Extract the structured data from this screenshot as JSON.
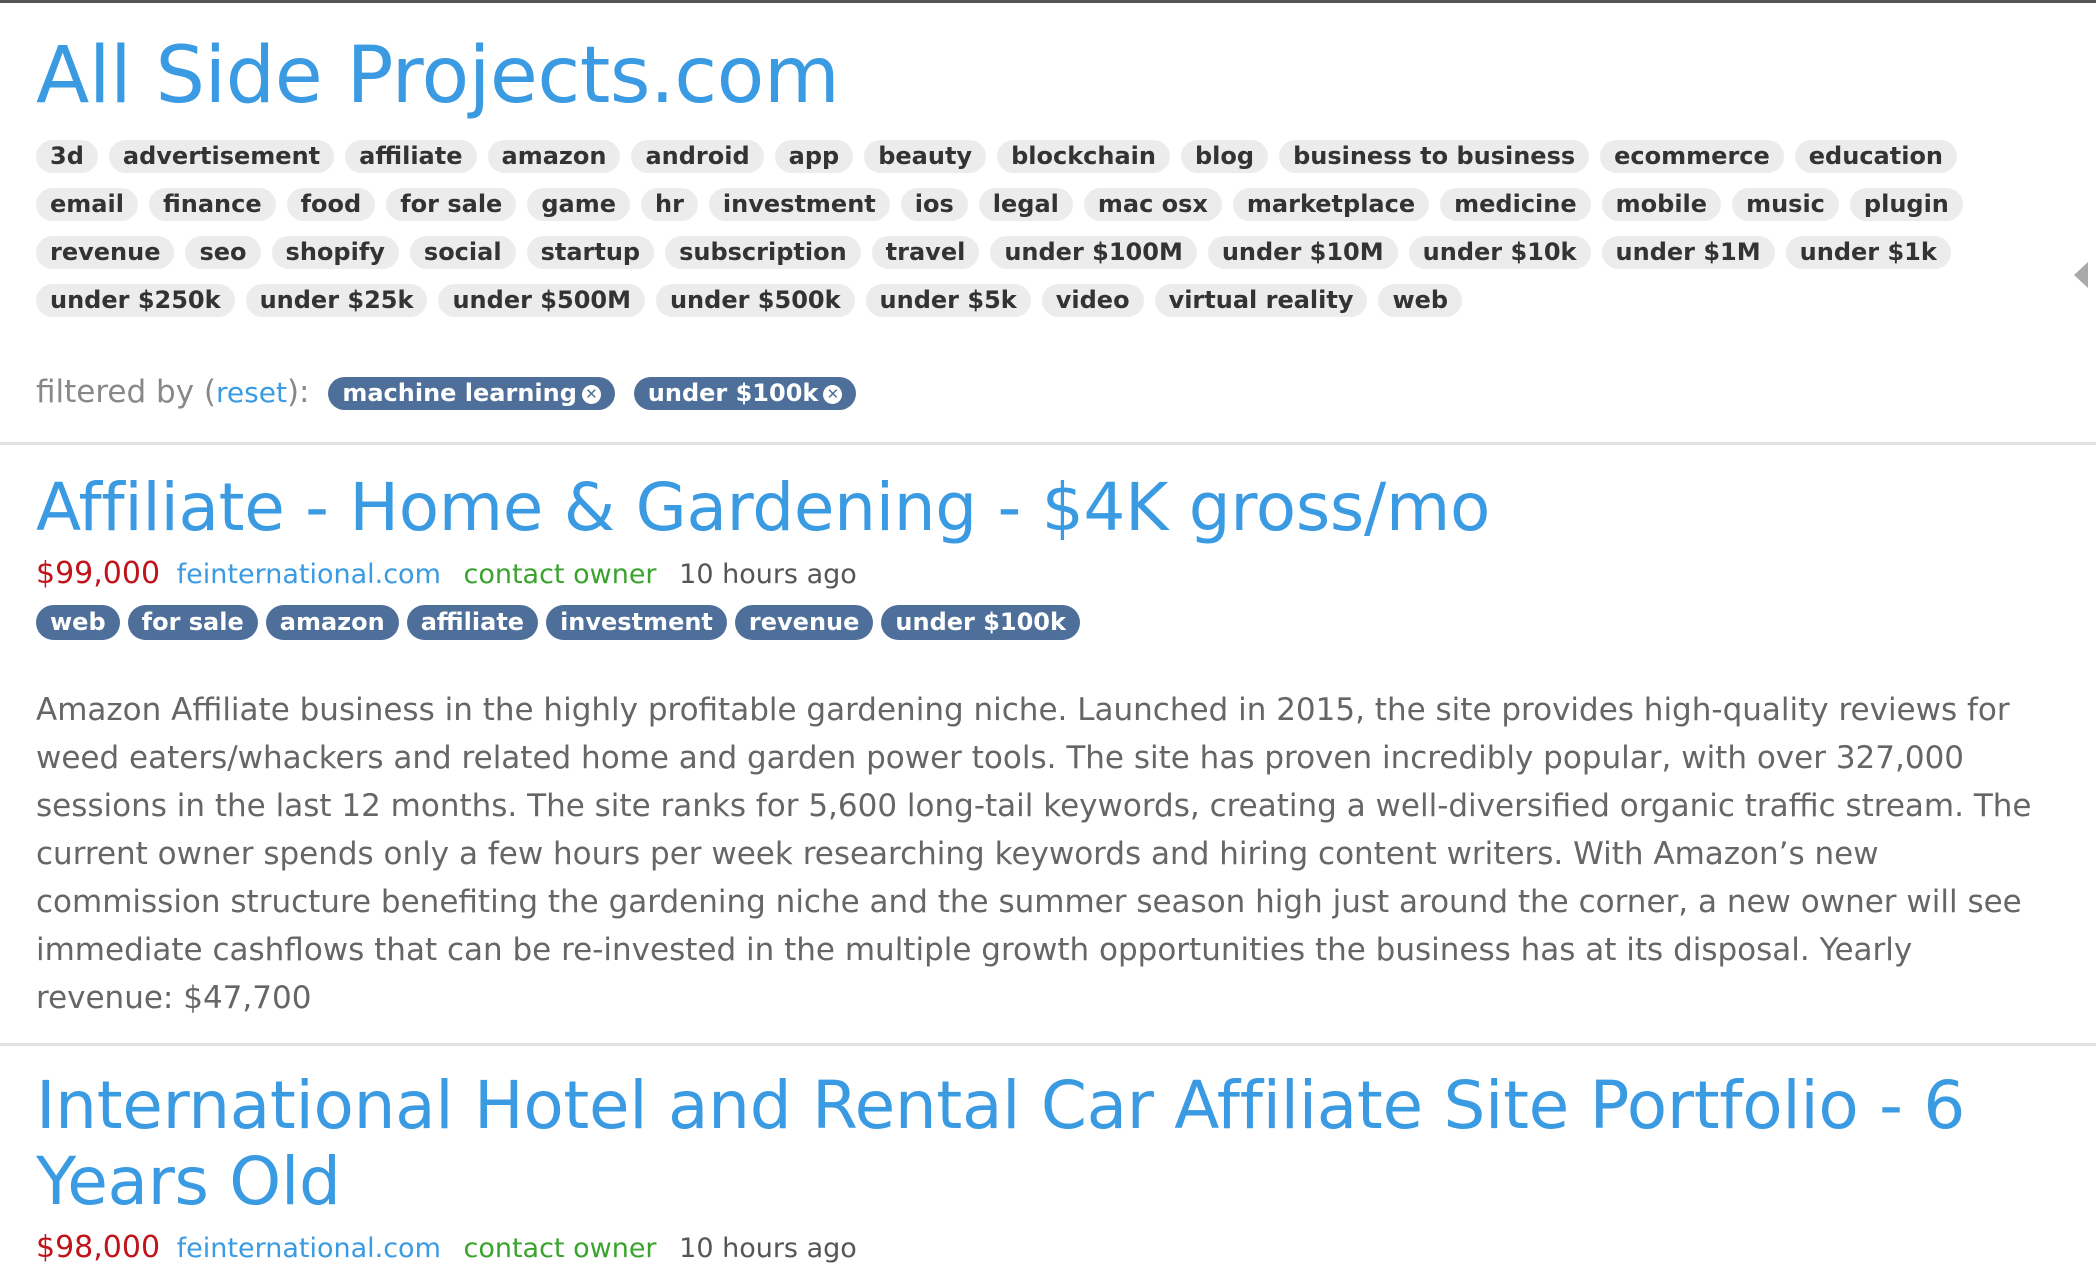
{
  "site": {
    "title": "All Side Projects.com"
  },
  "tags": [
    "3d",
    "advertisement",
    "affiliate",
    "amazon",
    "android",
    "app",
    "beauty",
    "blockchain",
    "blog",
    "business to business",
    "ecommerce",
    "education",
    "email",
    "finance",
    "food",
    "for sale",
    "game",
    "hr",
    "investment",
    "ios",
    "legal",
    "mac osx",
    "marketplace",
    "medicine",
    "mobile",
    "music",
    "plugin",
    "revenue",
    "seo",
    "shopify",
    "social",
    "startup",
    "subscription",
    "travel",
    "under $100M",
    "under $10M",
    "under $10k",
    "under $1M",
    "under $1k",
    "under $250k",
    "under $25k",
    "under $500M",
    "under $500k",
    "under $5k",
    "video",
    "virtual reality",
    "web"
  ],
  "filter": {
    "prefix": "filtered by (",
    "reset_label": "reset",
    "suffix": "):",
    "active": [
      "machine learning",
      "under $100k"
    ],
    "remove_glyph": "✕"
  },
  "listings": [
    {
      "title": "Affiliate - Home & Gardening - $4K gross/mo",
      "price": "$99,000",
      "source": "feinternational.com",
      "contact": "contact owner",
      "time": "10 hours ago",
      "tags": [
        "web",
        "for sale",
        "amazon",
        "affiliate",
        "investment",
        "revenue",
        "under $100k"
      ],
      "description": "Amazon Affiliate business in the highly profitable gardening niche. Launched in 2015, the site provides high-quality reviews for weed eaters/whackers and related home and garden power tools. The site has proven incredibly popular, with over 327,000 sessions in the last 12 months. The site ranks for 5,600 long-tail keywords, creating a well-diversified organic traffic stream. The current owner spends only a few hours per week researching keywords and hiring content writers. With Amazon’s new commission structure benefiting the gardening niche and the summer season high just around the corner, a new owner will see immediate cashflows that can be re-invested in the multiple growth opportunities the business has at its disposal. Yearly revenue: $47,700"
    },
    {
      "title": "International Hotel and Rental Car Affiliate Site Portfolio - 6 Years Old",
      "price": "$98,000",
      "source": "feinternational.com",
      "contact": "contact owner",
      "time": "10 hours ago"
    }
  ],
  "colors": {
    "link": "#3a9ae2",
    "price": "#c0141b",
    "contact": "#3aa32e",
    "chip": "#4d6f9a",
    "tag_bg": "#ececec"
  }
}
